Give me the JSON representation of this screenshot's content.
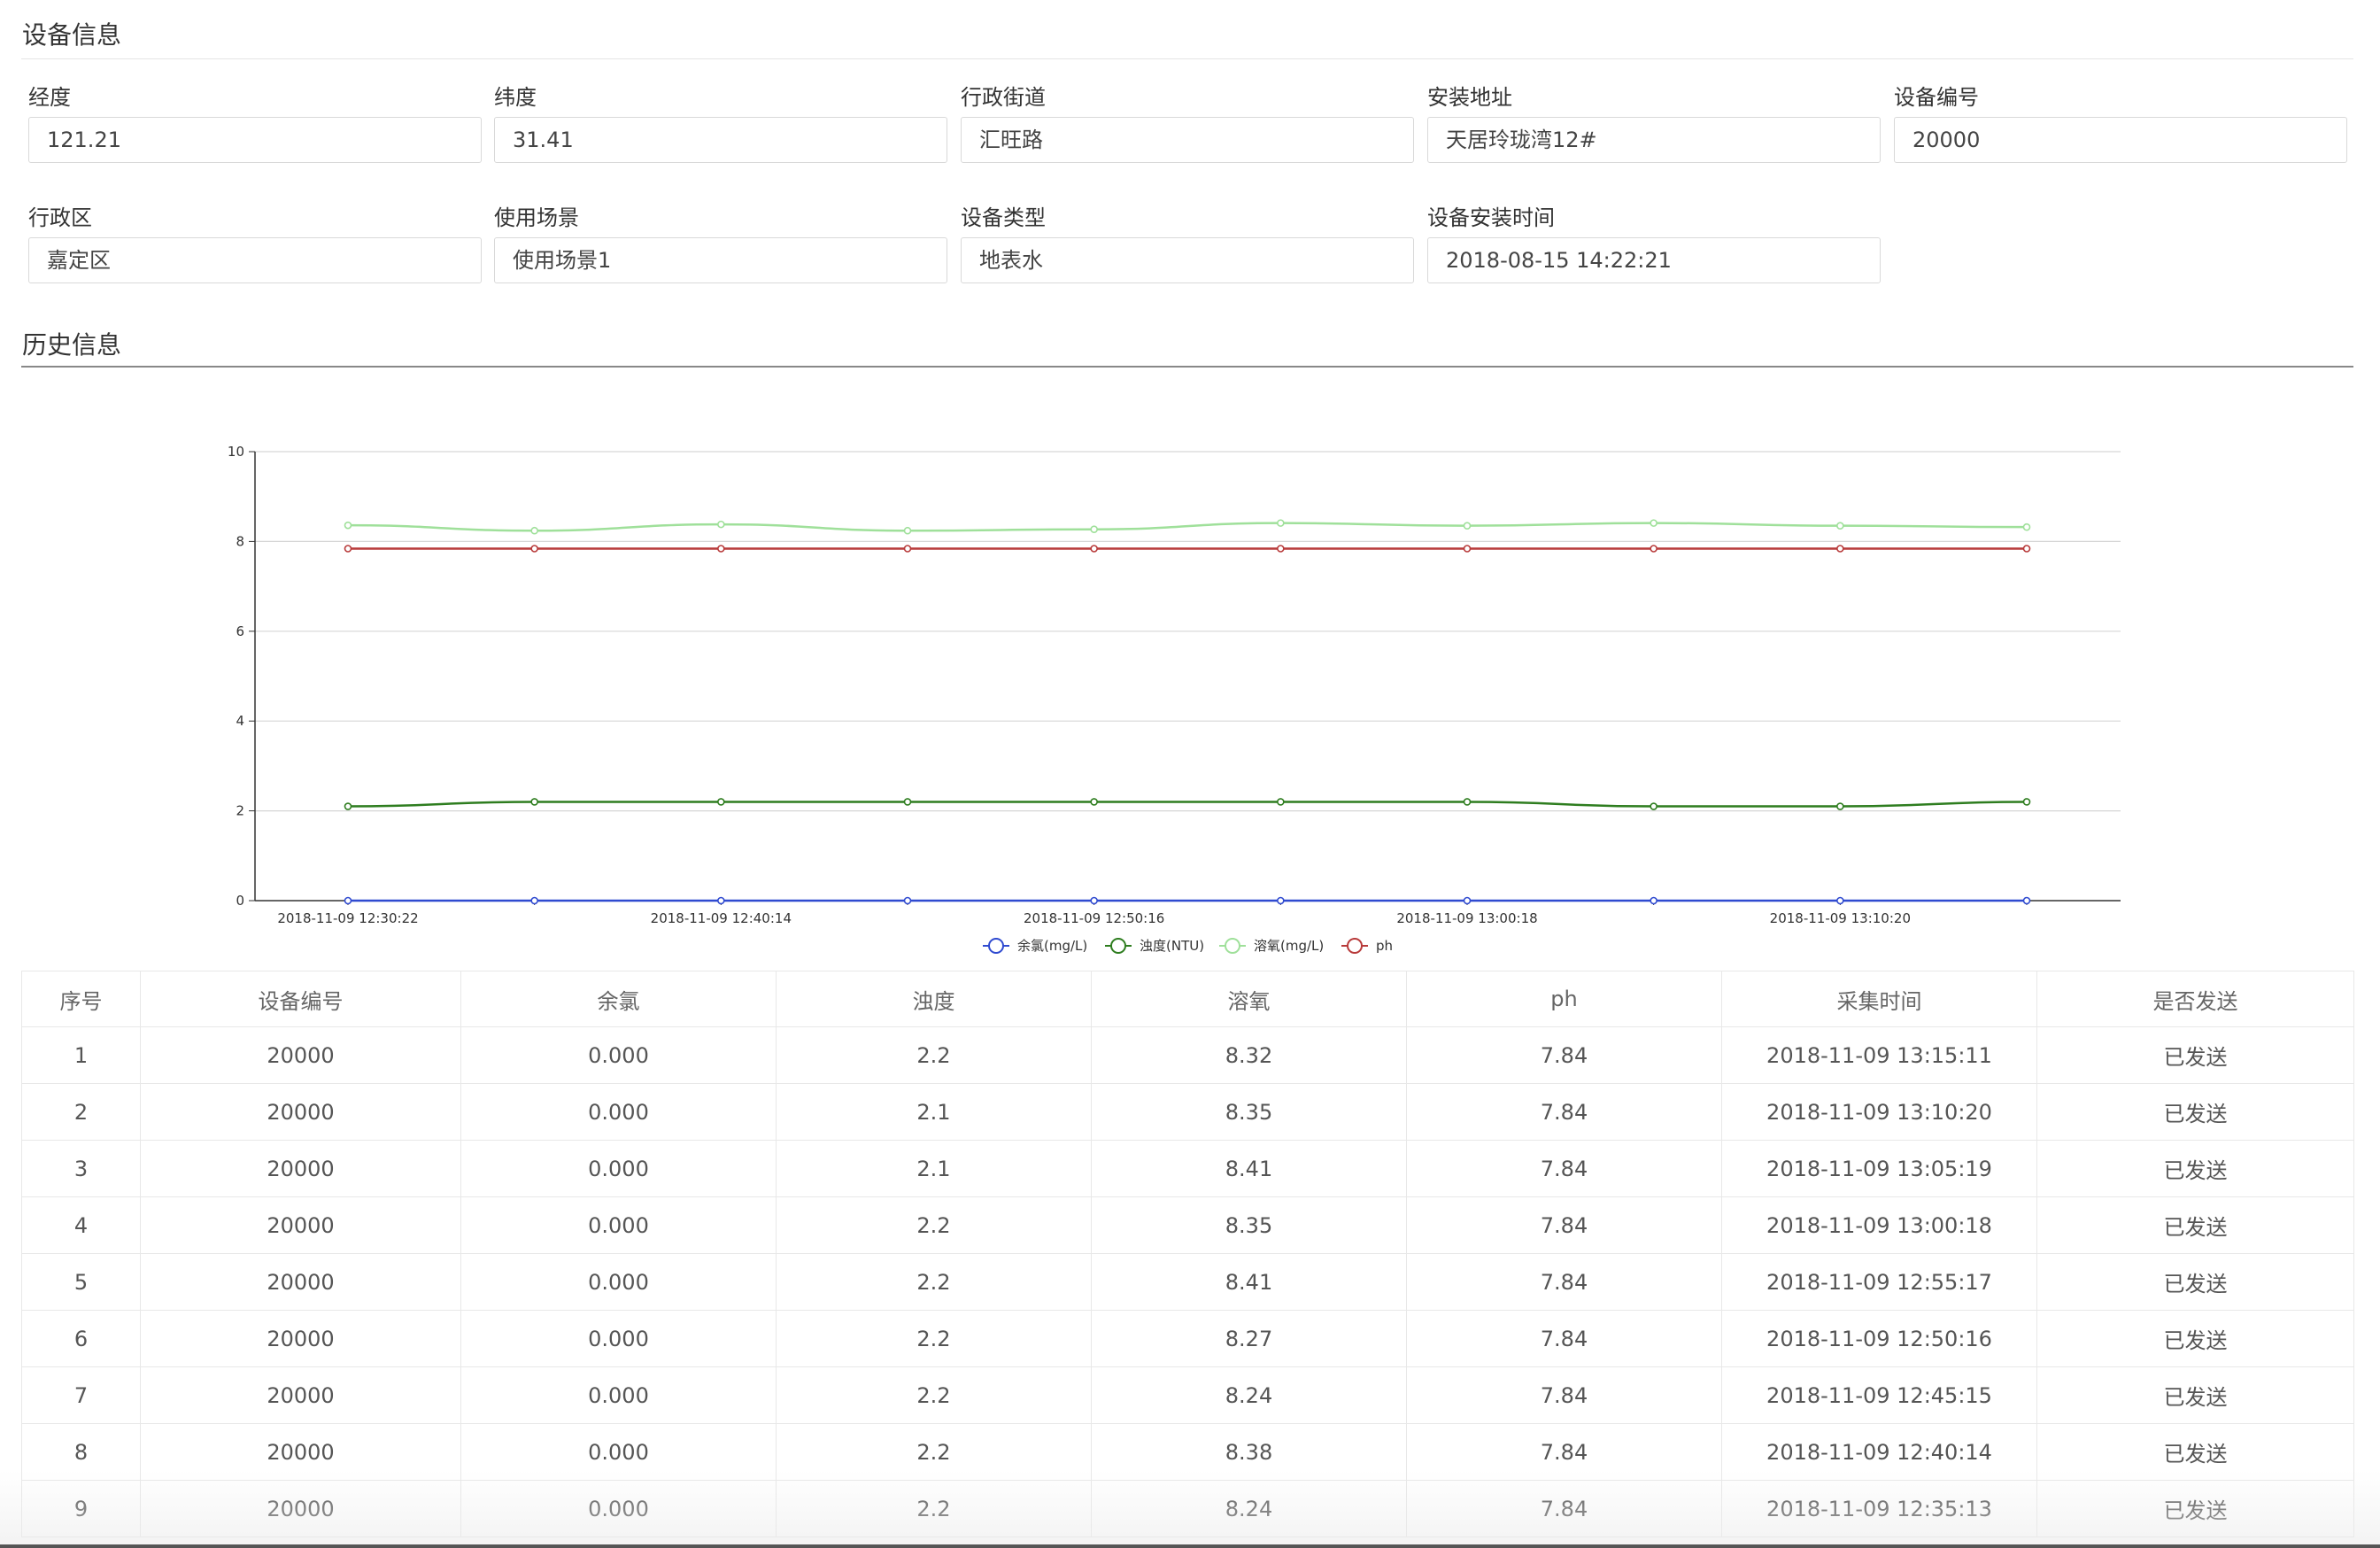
{
  "device_section": {
    "title": "设备信息",
    "fields": [
      {
        "label": "经度",
        "value": "121.21"
      },
      {
        "label": "纬度",
        "value": "31.41"
      },
      {
        "label": "行政街道",
        "value": "汇旺路"
      },
      {
        "label": "安装地址",
        "value": "天居玲珑湾12#"
      },
      {
        "label": "设备编号",
        "value": "20000"
      },
      {
        "label": "行政区",
        "value": "嘉定区"
      },
      {
        "label": "使用场景",
        "value": "使用场景1"
      },
      {
        "label": "设备类型",
        "value": "地表水"
      },
      {
        "label": "设备安装时间",
        "value": "2018-08-15 14:22:21"
      }
    ]
  },
  "history_section": {
    "title": "历史信息"
  },
  "chart_data": {
    "type": "line",
    "x_tick_labels": [
      "2018-11-09 12:30:22",
      "2018-11-09 12:40:14",
      "2018-11-09 12:50:16",
      "2018-11-09 13:00:18",
      "2018-11-09 13:10:20"
    ],
    "y_ticks": [
      0,
      2,
      4,
      6,
      8,
      10
    ],
    "ylim": [
      0,
      10
    ],
    "grid": true,
    "legend_position": "bottom-center",
    "series": [
      {
        "name": "余氯(mg/L)",
        "color": "#2f4ad0",
        "values": [
          0,
          0,
          0,
          0,
          0,
          0,
          0,
          0,
          0,
          0
        ]
      },
      {
        "name": "浊度(NTU)",
        "color": "#2e7d1f",
        "values": [
          2.1,
          2.2,
          2.2,
          2.2,
          2.2,
          2.2,
          2.2,
          2.1,
          2.1,
          2.2
        ]
      },
      {
        "name": "溶氧(mg/L)",
        "color": "#9fe09a",
        "values": [
          8.36,
          8.24,
          8.38,
          8.24,
          8.27,
          8.41,
          8.35,
          8.41,
          8.35,
          8.32
        ]
      },
      {
        "name": "ph",
        "color": "#b83a3a",
        "values": [
          7.84,
          7.84,
          7.84,
          7.84,
          7.84,
          7.84,
          7.84,
          7.84,
          7.84,
          7.84
        ]
      }
    ]
  },
  "table": {
    "headers": [
      "序号",
      "设备编号",
      "余氯",
      "浊度",
      "溶氧",
      "ph",
      "采集时间",
      "是否发送"
    ],
    "rows": [
      [
        "1",
        "20000",
        "0.000",
        "2.2",
        "8.32",
        "7.84",
        "2018-11-09 13:15:11",
        "已发送"
      ],
      [
        "2",
        "20000",
        "0.000",
        "2.1",
        "8.35",
        "7.84",
        "2018-11-09 13:10:20",
        "已发送"
      ],
      [
        "3",
        "20000",
        "0.000",
        "2.1",
        "8.41",
        "7.84",
        "2018-11-09 13:05:19",
        "已发送"
      ],
      [
        "4",
        "20000",
        "0.000",
        "2.2",
        "8.35",
        "7.84",
        "2018-11-09 13:00:18",
        "已发送"
      ],
      [
        "5",
        "20000",
        "0.000",
        "2.2",
        "8.41",
        "7.84",
        "2018-11-09 12:55:17",
        "已发送"
      ],
      [
        "6",
        "20000",
        "0.000",
        "2.2",
        "8.27",
        "7.84",
        "2018-11-09 12:50:16",
        "已发送"
      ],
      [
        "7",
        "20000",
        "0.000",
        "2.2",
        "8.24",
        "7.84",
        "2018-11-09 12:45:15",
        "已发送"
      ],
      [
        "8",
        "20000",
        "0.000",
        "2.2",
        "8.38",
        "7.84",
        "2018-11-09 12:40:14",
        "已发送"
      ],
      [
        "9",
        "20000",
        "0.000",
        "2.2",
        "8.24",
        "7.84",
        "2018-11-09 12:35:13",
        "已发送"
      ]
    ]
  }
}
